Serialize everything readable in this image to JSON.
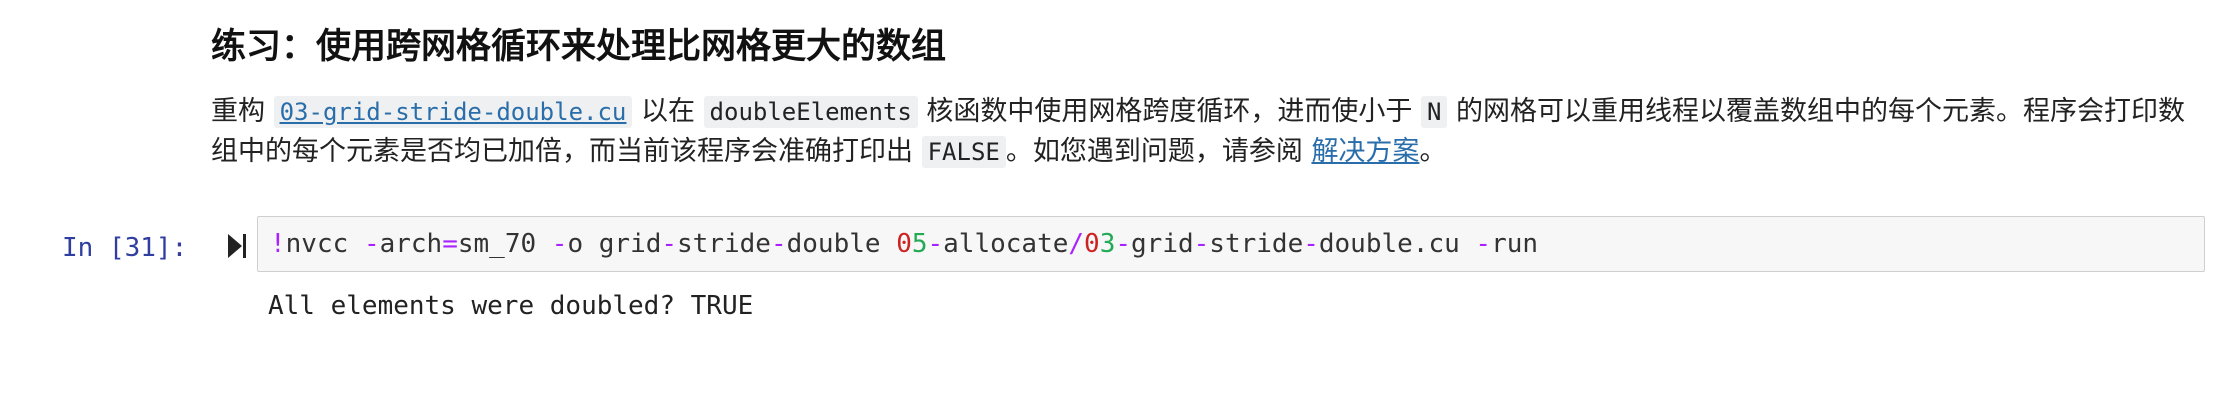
{
  "markdown": {
    "heading": "练习：使用跨网格循环来处理比网格更大的数组",
    "para": {
      "t1": "重构 ",
      "file_link": "03-grid-stride-double.cu",
      "t2": " 以在 ",
      "code_kernel": "doubleElements",
      "t3": " 核函数中使用网格跨度循环，进而使小于 ",
      "code_n": "N",
      "t4": " 的网格可以重用线程以覆盖数组中的每个元素。程序会打印数组中的每个元素是否均已加倍，而当前该程序会准确打印出 ",
      "code_false": "FALSE",
      "t5": "。如您遇到问题，请参阅 ",
      "solution_link": "解决方案",
      "t6": "。"
    }
  },
  "code_cell": {
    "prompt": "In  [31]:",
    "run_icon": "run-cell-icon",
    "code_tokens": {
      "bang": "!",
      "cmd": "nvcc ",
      "op1": "-",
      "arch": "arch",
      "eq": "=",
      "sm": "sm_70 ",
      "op2": "-",
      "o": "o grid",
      "op3": "-",
      "stride": "stride",
      "op4": "-",
      "double": "double ",
      "n0": "0",
      "n5": "5",
      "op5": "-",
      "allocate": "allocate",
      "slash": "/",
      "n03a": "0",
      "n03b": "3",
      "op6": "-",
      "grid2": "grid",
      "op7": "-",
      "stride2": "stride",
      "op8": "-",
      "double2": "double.cu ",
      "op9": "-",
      "run": "run"
    },
    "output": "All elements were doubled? TRUE"
  },
  "colors": {
    "prompt": "#303f9f",
    "link": "#296eaa",
    "code_bg": "#f7f7f7",
    "keyword_purple": "#aa22ff",
    "number_red": "#cc2222"
  }
}
